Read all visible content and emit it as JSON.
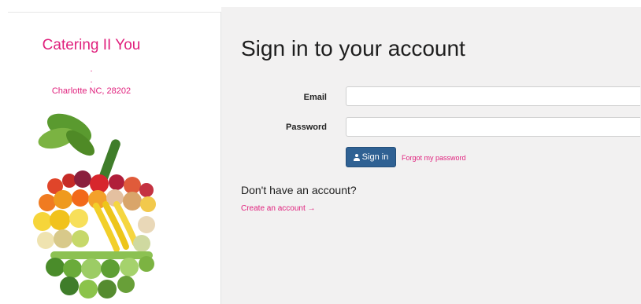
{
  "sidebar": {
    "brand": "Catering II You",
    "address_line_1": ".",
    "address_line_2": ".",
    "address_line_3": "Charlotte NC, 28202",
    "image_icon": "vegetable-apple-illustration"
  },
  "main": {
    "heading": "Sign in to your account",
    "email_label": "Email",
    "email_value": "",
    "password_label": "Password",
    "password_value": "",
    "signin_icon": "user-icon",
    "signin_label": "Sign in",
    "forgot_label": "Forgot my password",
    "no_account_text": "Don't have an account?",
    "create_account_label": "Create an account →"
  },
  "colors": {
    "brand_pink": "#e0217d",
    "button_blue": "#2f6193",
    "panel_bg": "#f2f1f1"
  }
}
